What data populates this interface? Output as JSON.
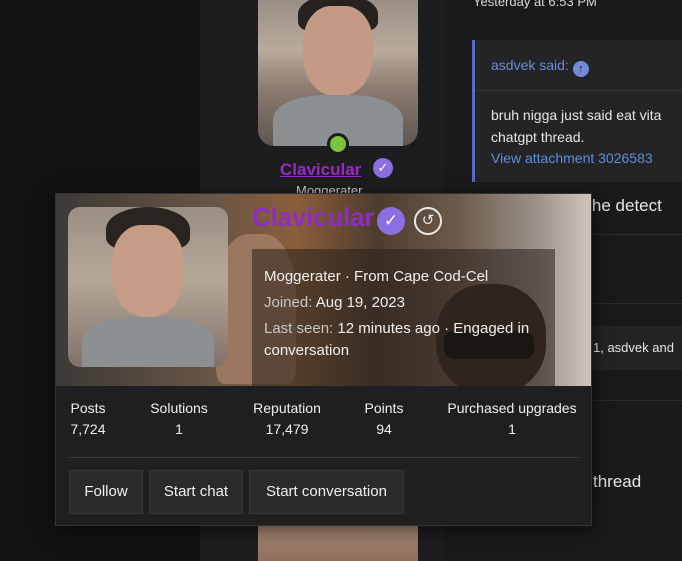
{
  "background_post": {
    "username": "Clavicular",
    "role": "Moggerater",
    "online_color": "#7cc43a"
  },
  "thread": {
    "timestamp": "Yesterday at 6:53 PM",
    "quote": {
      "author_said": "asdvek said:",
      "body_line1": "bruh nigga just said eat vita",
      "body_line2": "chatgpt thread.",
      "attachment_link": "View attachment 3026583"
    },
    "text_after_quote": "n the detect",
    "reactions_text": "1, asdvek and",
    "text_bottom": "thread"
  },
  "popup": {
    "username": "Clavicular",
    "verified_icon": "verified-badge-icon",
    "history_icon": "history-icon",
    "info": {
      "title_location": "Moggerater · From Cape Cod-Cel",
      "joined_label": "Joined:",
      "joined_value": "Aug 19, 2023",
      "last_seen_label": "Last seen:",
      "last_seen_value": "12 minutes ago · Engaged in conversation"
    },
    "stats": [
      {
        "label": "Posts",
        "value": "7,724"
      },
      {
        "label": "Solutions",
        "value": "1"
      },
      {
        "label": "Reputation",
        "value": "17,479"
      },
      {
        "label": "Points",
        "value": "94"
      },
      {
        "label": "Purchased upgrades",
        "value": "1"
      }
    ],
    "buttons": {
      "follow": "Follow",
      "start_chat": "Start chat",
      "start_conversation": "Start conversation"
    }
  },
  "colors": {
    "username": "#8e2cc4",
    "verified": "#8b6ee0",
    "link": "#5e8ddb",
    "quote_border": "#5a69c8"
  }
}
